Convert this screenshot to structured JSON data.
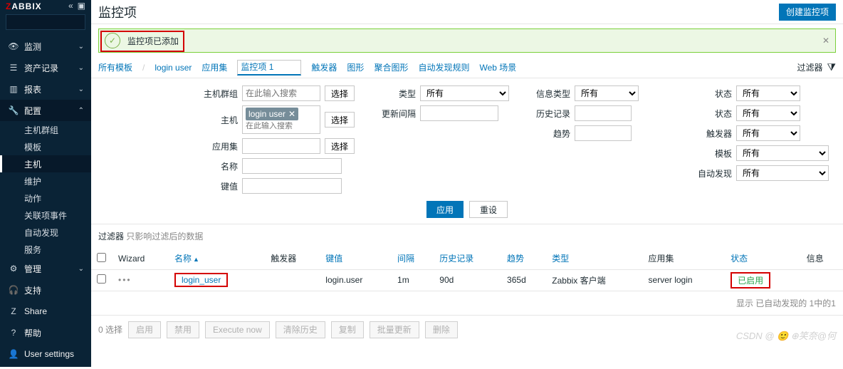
{
  "logo": {
    "z": "Z",
    "rest": "ABBIX"
  },
  "sidebar": {
    "search_placeholder": "",
    "items": [
      {
        "icon": "eye",
        "label": "监测",
        "chev": true
      },
      {
        "icon": "list",
        "label": "资产记录",
        "chev": true
      },
      {
        "icon": "bar",
        "label": "报表",
        "chev": true
      },
      {
        "icon": "wrench",
        "label": "配置",
        "chev": true,
        "active": true
      }
    ],
    "sub": [
      "主机群组",
      "模板",
      "主机",
      "维护",
      "动作",
      "关联项事件",
      "自动发现",
      "服务"
    ],
    "sub_selected": 2,
    "admin": {
      "icon": "gear",
      "label": "管理",
      "chev": true
    },
    "bottom": [
      {
        "icon": "headset",
        "label": "支持"
      },
      {
        "icon": "z",
        "label": "Share"
      },
      {
        "icon": "help",
        "label": "帮助"
      },
      {
        "icon": "user",
        "label": "User settings"
      }
    ]
  },
  "page_title": "监控项",
  "create_btn": "创建监控项",
  "message": "监控项已添加",
  "tabs": [
    {
      "label": "所有模板"
    },
    {
      "label": "login user"
    },
    {
      "label": "应用集"
    },
    {
      "label": "监控项",
      "count": "1",
      "sel": true
    },
    {
      "label": "触发器"
    },
    {
      "label": "图形"
    },
    {
      "label": "聚合图形"
    },
    {
      "label": "自动发现规则"
    },
    {
      "label": "Web 场景"
    }
  ],
  "filter_label": "过滤器",
  "filter": {
    "col1": {
      "hostgroup": {
        "label": "主机群组",
        "ph": "在此输入搜索",
        "btn": "选择"
      },
      "host": {
        "label": "主机",
        "tag": "login user",
        "ph": "在此输入搜索",
        "btn": "选择"
      },
      "appset": {
        "label": "应用集",
        "btn": "选择"
      },
      "name": {
        "label": "名称"
      },
      "key": {
        "label": "键值"
      }
    },
    "col2": {
      "type": {
        "label": "类型",
        "val": "所有"
      },
      "interval": {
        "label": "更新间隔"
      },
      "spacer": ""
    },
    "col3": {
      "infotype": {
        "label": "信息类型",
        "val": "所有"
      },
      "history": {
        "label": "历史记录"
      },
      "trend": {
        "label": "趋势"
      }
    },
    "col4": {
      "state": {
        "label": "状态",
        "val": "所有"
      },
      "status": {
        "label": "状态",
        "val": "所有"
      },
      "trigger": {
        "label": "触发器",
        "val": "所有"
      },
      "template": {
        "label": "模板",
        "val": "所有"
      },
      "discovery": {
        "label": "自动发现",
        "val": "所有"
      }
    },
    "apply": "应用",
    "reset": "重设"
  },
  "subfilter": {
    "label": "过滤器",
    "note": "只影响过滤后的数据"
  },
  "columns": [
    "Wizard",
    "名称",
    "触发器",
    "键值",
    "间隔",
    "历史记录",
    "趋势",
    "类型",
    "应用集",
    "状态",
    "信息"
  ],
  "sort_col": 1,
  "rows": [
    {
      "wizard": "•••",
      "name": "login_user",
      "trigger": "",
      "key": "login.user",
      "interval": "1m",
      "history": "90d",
      "trend": "365d",
      "type": "Zabbix 客户端",
      "appset": "server login",
      "status": "已启用",
      "info": ""
    }
  ],
  "footer": "显示 已自动发现的 1中的1",
  "bulk": {
    "count": "0 选择",
    "buttons": [
      "启用",
      "禁用",
      "Execute now",
      "清除历史",
      "复制",
      "批量更新",
      "删除"
    ]
  },
  "watermark": "CSDN @ 🙂 ⊕笑奈@何"
}
